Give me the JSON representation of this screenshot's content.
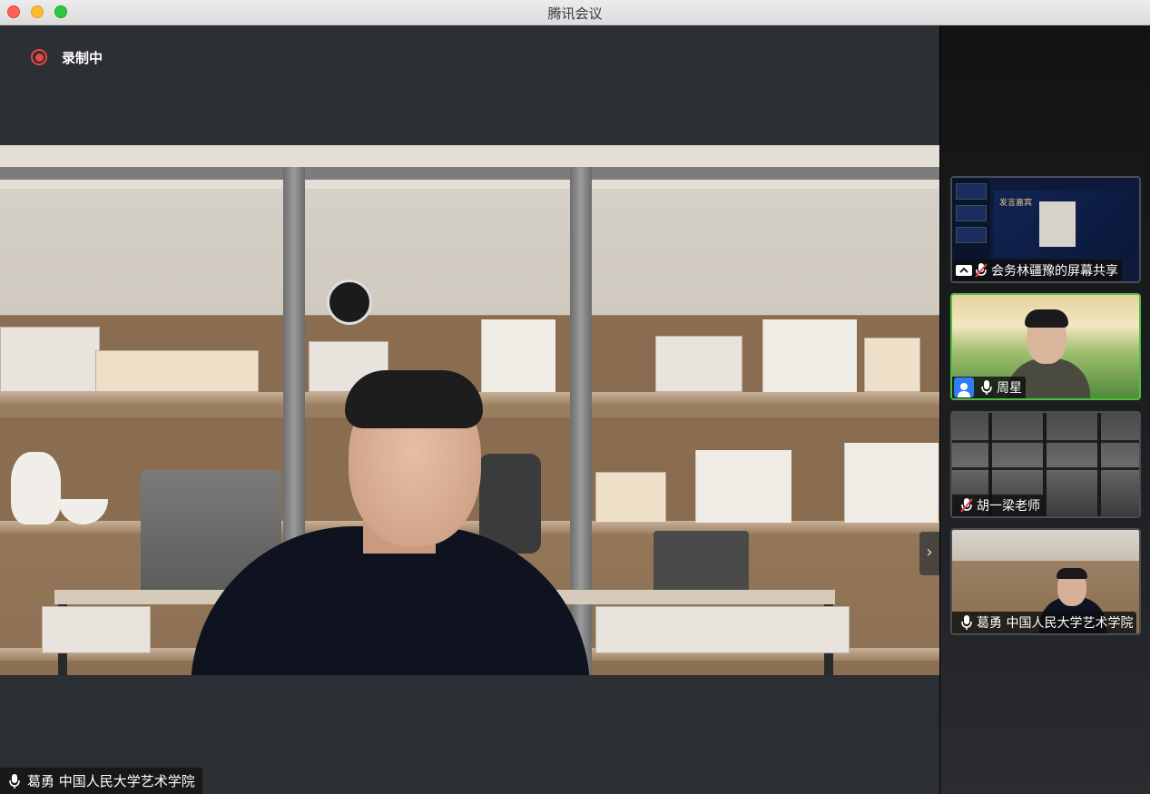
{
  "window": {
    "title": "腾讯会议"
  },
  "recording": {
    "label": "录制中",
    "color": "#e9483f"
  },
  "main_speaker": {
    "name": "葛勇 中国人民大学艺术学院",
    "mic": "mic-icon"
  },
  "participants": [
    {
      "name": "会务林疆豫的屏幕共享",
      "icons": [
        "screen-share-icon",
        "mic-muted-icon"
      ],
      "active": false
    },
    {
      "name": "周星",
      "icons": [
        "avatar-icon",
        "mic-icon"
      ],
      "active": true
    },
    {
      "name": "胡一梁老师",
      "icons": [
        "mic-muted-icon"
      ],
      "active": false
    },
    {
      "name": "葛勇 中国人民大学艺术学院",
      "icons": [
        "mic-icon"
      ],
      "active": false
    }
  ],
  "shared_slide": {
    "title": "发言嘉宾"
  },
  "colors": {
    "active_border": "#4fbe3f",
    "stage_bg": "#2c2f33",
    "avatar_blue": "#2f7cf6"
  }
}
